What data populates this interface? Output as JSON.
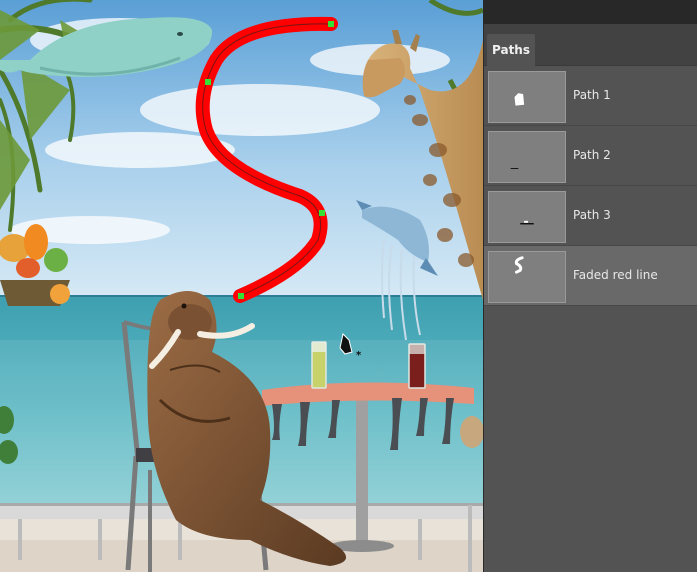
{
  "panel": {
    "tab_label": "Paths",
    "paths": [
      {
        "name": "Path 1",
        "selected": false,
        "thumb_icon": "filled-shape-thumbnail"
      },
      {
        "name": "Path 2",
        "selected": false,
        "thumb_icon": "short-line-thumbnail"
      },
      {
        "name": "Path 3",
        "selected": false,
        "thumb_icon": "line-thumbnail"
      },
      {
        "name": "Faded red line",
        "selected": true,
        "thumb_icon": "curved-stroke-thumbnail"
      }
    ]
  },
  "canvas": {
    "stroke_color": "#ff0000",
    "anchor_color": "#34e234",
    "cursor_icon": "pen-add-anchor-icon"
  }
}
